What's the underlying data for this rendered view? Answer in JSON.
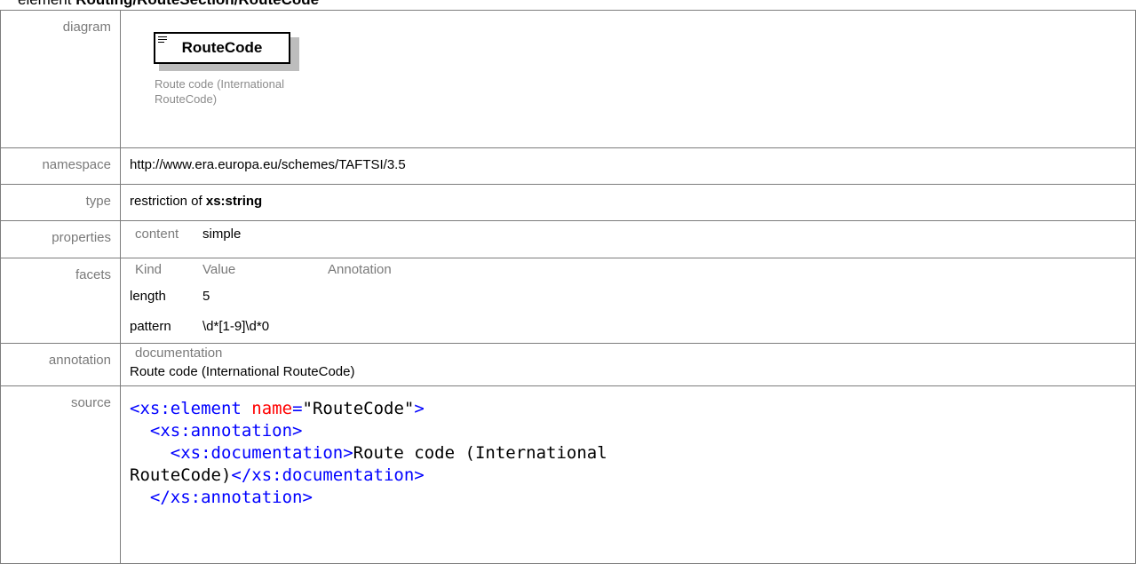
{
  "heading": {
    "prefix": "element ",
    "path": "Routing/RouteSection/RouteCode"
  },
  "rows": {
    "diagram": {
      "label": "diagram",
      "box_label": "RouteCode",
      "box_icon": "list-icon",
      "description_line1": "Route code (International",
      "description_line2": "RouteCode)"
    },
    "namespace": {
      "label": "namespace",
      "value": "http://www.era.europa.eu/schemes/TAFTSI/3.5"
    },
    "type": {
      "label": "type",
      "prefix": "restriction of ",
      "base": "xs:string"
    },
    "properties": {
      "label": "properties",
      "key": "content",
      "value": "simple"
    },
    "facets": {
      "label": "facets",
      "headers": [
        "Kind",
        "Value",
        "Annotation"
      ],
      "rows": [
        {
          "kind": "length",
          "value": "5",
          "annotation": ""
        },
        {
          "kind": "pattern",
          "value": "\\d*[1-9]\\d*0",
          "annotation": ""
        }
      ]
    },
    "annotation": {
      "label": "annotation",
      "key": "documentation",
      "value": "Route code (International RouteCode)"
    },
    "source": {
      "label": "source",
      "line1_open": "<",
      "line1_tag": "xs:element",
      "line1_attr": "name",
      "line1_eq": "=",
      "line1_val": "\"RouteCode\"",
      "line1_close": ">",
      "line2": "<xs:annotation>",
      "line3_tag": "<xs:documentation>",
      "line3_text": "Route code (International",
      "line4_text": "RouteCode)",
      "line4_tag": "</xs:documentation>",
      "line5": "</xs:annotation>"
    }
  },
  "colors": {
    "border": "#7d7d7d",
    "label_gray": "#7a7a7a",
    "xml_tag": "#0000ff",
    "xml_attr": "#ff0000"
  }
}
